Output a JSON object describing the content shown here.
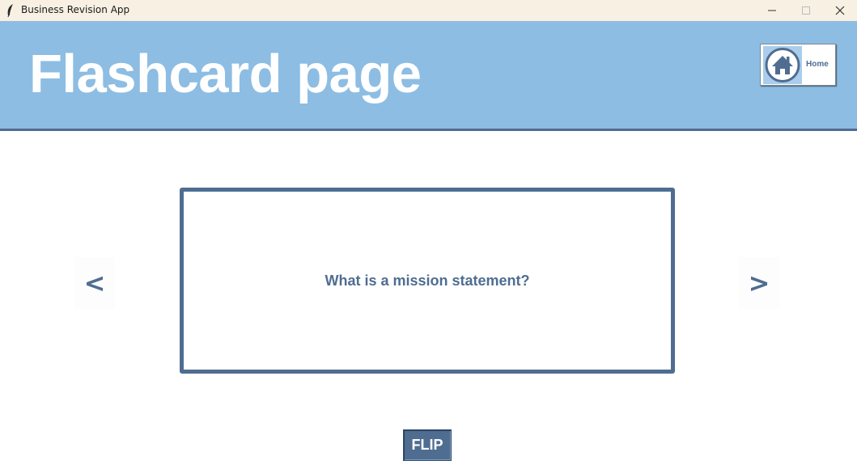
{
  "window": {
    "title": "Business Revision App",
    "controls": {
      "minimize_icon": "minimize-icon",
      "maximize_icon": "maximize-icon",
      "close_icon": "close-icon"
    }
  },
  "header": {
    "title": "Flashcard page",
    "background_color": "#8dbde3",
    "home_button": {
      "label": "Home",
      "icon": "home-icon"
    }
  },
  "flashcard": {
    "text": "What is a mission statement?",
    "accent_color": "#4f6d91"
  },
  "navigation": {
    "prev_label": "<",
    "next_label": ">"
  },
  "actions": {
    "flip_label": "FLIP"
  }
}
